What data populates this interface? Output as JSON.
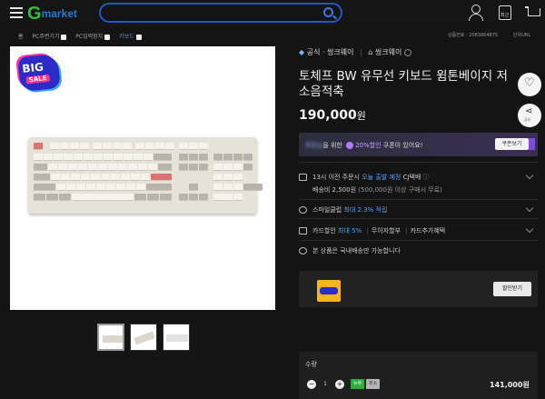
{
  "header": {
    "logo_g": "G",
    "logo_market": "market",
    "search_placeholder": "",
    "recent_label": "최근"
  },
  "breadcrumb": {
    "home": "홈",
    "items": [
      "PC주변기기",
      "PC입력장치",
      "키보드"
    ],
    "product_no": "상품번호 : 2083664875",
    "unit_price": "단위URL"
  },
  "gallery": {
    "badge_big": "BIG",
    "badge_sale": "SALE"
  },
  "product": {
    "store_official": "공식 · 씽크웨이",
    "store_name": "씽크웨이",
    "title": "토체프 BW 유무선 키보드 윔톤베이지 저소음적축",
    "price": "190,000",
    "price_unit": "원",
    "share_label": "공유"
  },
  "coupon": {
    "blurred": "회원님",
    "text_a": "을 위한",
    "discount": "20%할인",
    "text_b": "쿠폰이 있어요!",
    "button": "쿠폰보기"
  },
  "shipping": {
    "line1_a": "13시 이전 주문시",
    "line1_b": "오늘 출발 예정",
    "line1_c": "CJ택배",
    "line2": "배송비 2,500원",
    "line2_sub": "(500,000원 이상 구매시 무료)"
  },
  "smile": {
    "text": "스마일클럽",
    "highlight": "최대 2.3% 적립"
  },
  "card": {
    "text": "카드할인",
    "highlight": "최대 5%",
    "item2": "무이자할부",
    "item3": "카드추가혜택"
  },
  "domestic": {
    "text": "본 상품은 국내배송만 가능합니다"
  },
  "banner": {
    "button": "할인받기"
  },
  "order": {
    "qty_label": "수량",
    "qty": "1",
    "minus": "−",
    "plus": "+",
    "tag1": "뉴뷰",
    "tag2": "최소",
    "total": "141,000원",
    "close": "✕"
  }
}
